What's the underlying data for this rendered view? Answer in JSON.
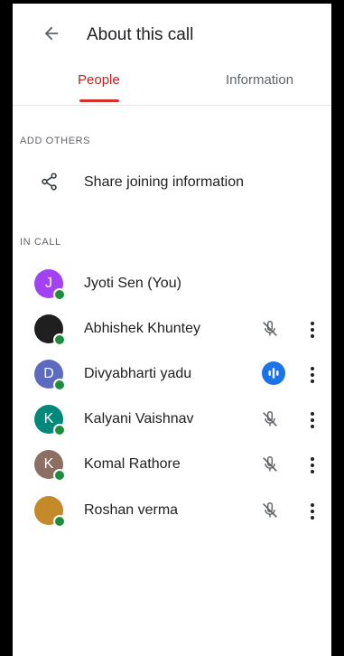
{
  "header": {
    "title": "About this call",
    "back_icon": "arrow-left-icon"
  },
  "tabs": [
    {
      "label": "People",
      "active": true
    },
    {
      "label": "Information",
      "active": false
    }
  ],
  "add_others": {
    "heading": "ADD OTHERS",
    "share_label": "Share joining information",
    "icon": "share-icon"
  },
  "in_call": {
    "heading": "IN CALL",
    "people": [
      {
        "name": "Jyoti Sen (You)",
        "initial": "J",
        "avatar_color": "#a142f4",
        "mic": "none"
      },
      {
        "name": "Abhishek Khuntey",
        "initial": "",
        "avatar_color": "#1f1f1f",
        "mic": "muted"
      },
      {
        "name": "Divyabharti yadu",
        "initial": "D",
        "avatar_color": "#5c6bc0",
        "mic": "speaking"
      },
      {
        "name": "Kalyani Vaishnav",
        "initial": "K",
        "avatar_color": "#00897b",
        "mic": "muted"
      },
      {
        "name": "Komal Rathore",
        "initial": "K",
        "avatar_color": "#8d6e63",
        "mic": "muted"
      },
      {
        "name": "Roshan verma",
        "initial": "",
        "avatar_color": "#c48a2a",
        "mic": "muted"
      }
    ]
  },
  "colors": {
    "accent": "#d93025",
    "online": "#1e8e3e",
    "speaking": "#1a73e8"
  }
}
